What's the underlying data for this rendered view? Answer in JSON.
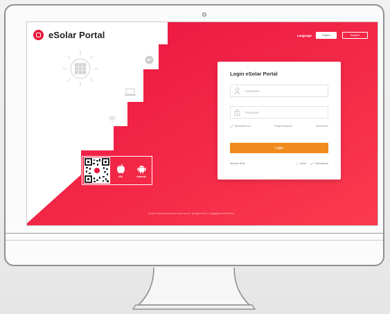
{
  "header": {
    "brand_name": "eSolar Portal",
    "language_label": "Language",
    "language_value": "English",
    "register_label": "Register"
  },
  "login": {
    "title": "Login eSolar Portal",
    "username_placeholder": "Username",
    "password_placeholder": "Password",
    "remember_label": "Remember me",
    "forgot_label": "Forget Password",
    "plant_demo_label": "Plant Demo",
    "login_label": "Login",
    "network_node_label": "Network Node",
    "node_options": [
      "China",
      "International"
    ]
  },
  "apps": {
    "ios_label": "iOS",
    "android_label": "Android"
  },
  "footer": {
    "text": "Copyright © 2020-2021 SAJ Electric All rights reserved · 粤ICP备XXXXXX号-1 · 粤公网安备 XXXXXXXXXXXX号"
  },
  "colors": {
    "brand_red": "#e8143a",
    "login_orange": "#f08a1c",
    "card_bg": "#ffffff"
  }
}
